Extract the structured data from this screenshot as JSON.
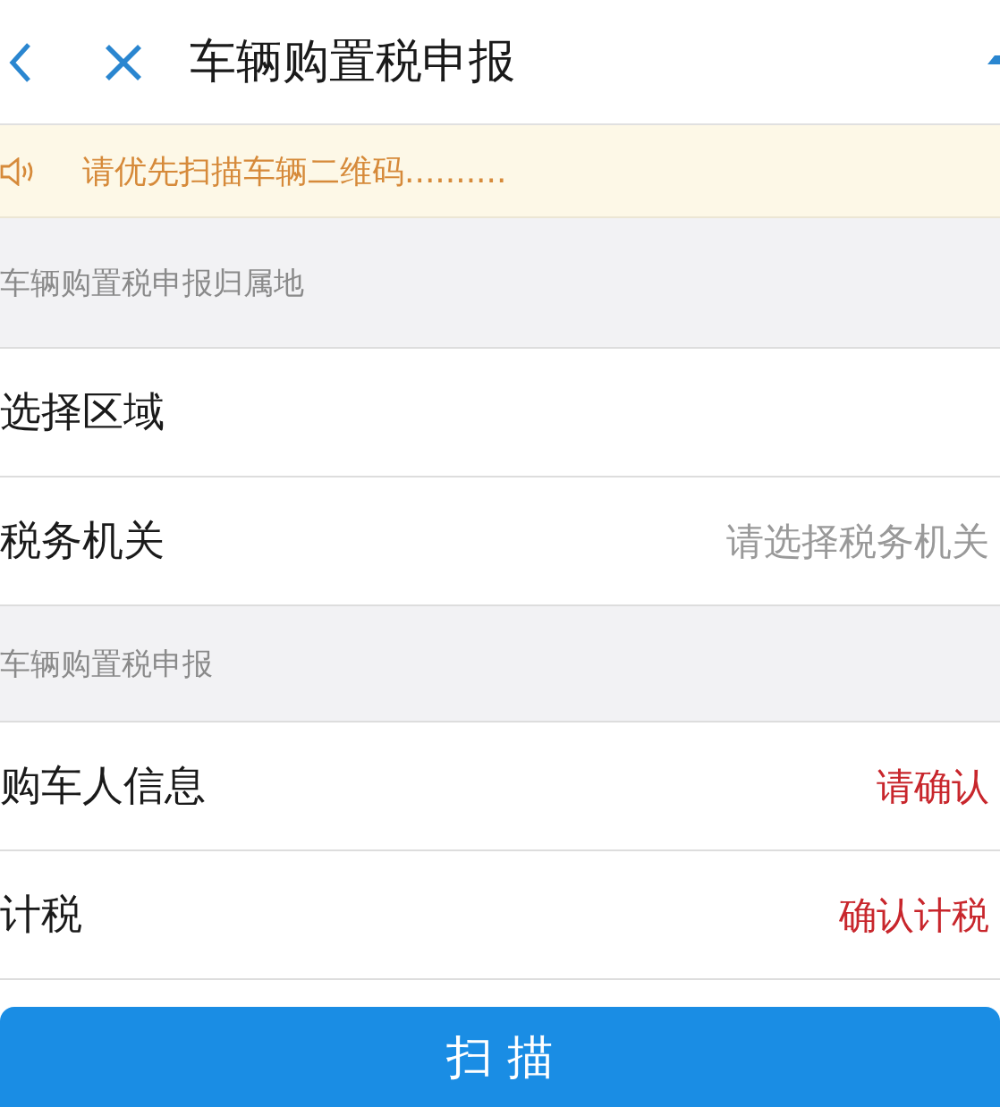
{
  "header": {
    "title": "车辆购置税申报"
  },
  "notice": {
    "text": "请优先扫描车辆二维码.........."
  },
  "items": [
    {
      "kind": "section",
      "label": "车辆购置税申报归属地"
    },
    {
      "kind": "row",
      "label": "选择区域"
    },
    {
      "kind": "row",
      "label": "税务机关",
      "value": "请选择税务机关",
      "color": "#999999"
    },
    {
      "kind": "section",
      "label": "车辆购置税申报"
    },
    {
      "kind": "row",
      "label": "购车人信息",
      "value": "请确认",
      "color": "#c8262c"
    },
    {
      "kind": "row",
      "label": "计税",
      "value": "确认计税",
      "color": "#c8262c"
    }
  ],
  "button": {
    "label": "扫 描"
  }
}
